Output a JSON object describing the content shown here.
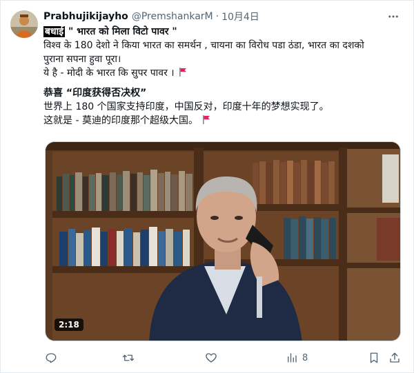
{
  "tweet": {
    "author_name": "Prabhujikijayho",
    "author_handle": "@PremshankarM",
    "separator": "·",
    "date": "10月4日",
    "hindi": {
      "line1_lead": "बधाई",
      "line1_quote": " \" भारत को मिला विटो पावर \"",
      "line2": "विश्व के 180 देशो ने किया भारत का समर्थन , चायना का विरोध पडा ठंडा, भारत का दशको",
      "line3": "पुराना सपना हुवा पूरा।",
      "line4": "ये है - मोदी के भारत कि सुपर पावर ।"
    },
    "chinese": {
      "line1": "恭喜 “印度获得否决权”",
      "line2": "世界上 180 个国家支持印度，中国反对，印度十年的梦想实现了。",
      "line3": "这就是 - 莫迪的印度那个超级大国。"
    },
    "video": {
      "duration": "2:18"
    },
    "actions": {
      "views": "8"
    }
  },
  "colors": {
    "flag": "#e0245e",
    "secondary_text": "#536471"
  },
  "icons": [
    "more-icon",
    "flag-icon",
    "reply-icon",
    "retweet-icon",
    "like-icon",
    "views-icon",
    "bookmark-icon",
    "share-icon"
  ]
}
